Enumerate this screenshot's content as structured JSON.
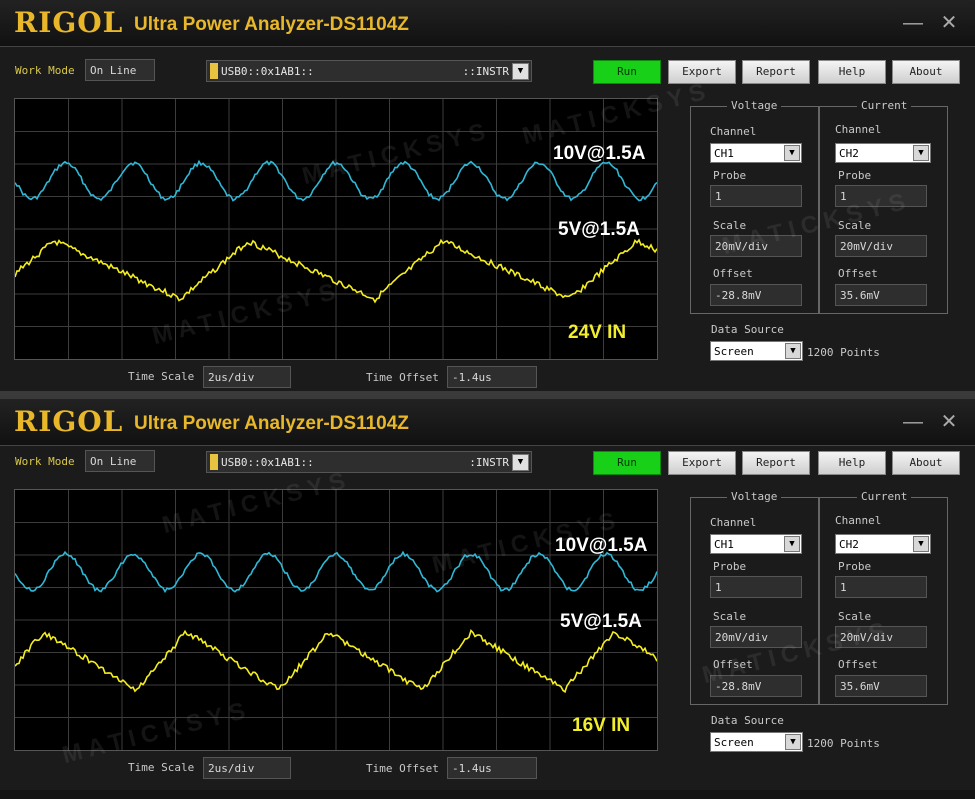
{
  "windows": [
    {
      "logo": "RIGOL",
      "app_title": "Ultra Power Analyzer-DS1104Z",
      "work_mode_label": "Work Mode",
      "work_mode_value": "On Line",
      "usb_resource": "USB0::0x1AB1::",
      "usb_suffix": "::INSTR",
      "buttons": {
        "run": "Run",
        "export": "Export",
        "report": "Report",
        "help": "Help",
        "about": "About"
      },
      "overlay_labels": {
        "upper": "10V@1.5A",
        "lower": "5V@1.5A",
        "input": "24V IN"
      },
      "voltage": {
        "title": "Voltage",
        "channel_label": "Channel",
        "channel": "CH1",
        "probe_label": "Probe",
        "probe": "1",
        "scale_label": "Scale",
        "scale": "20mV/div",
        "offset_label": "Offset",
        "offset": "-28.8mV"
      },
      "current": {
        "title": "Current",
        "channel_label": "Channel",
        "channel": "CH2",
        "probe_label": "Probe",
        "probe": "1",
        "scale_label": "Scale",
        "scale": "20mV/div",
        "offset_label": "Offset",
        "offset": "35.6mV"
      },
      "data_source_label": "Data Source",
      "data_source": "Screen",
      "points": "1200 Points",
      "time_scale_label": "Time Scale",
      "time_scale": "2us/div",
      "time_offset_label": "Time Offset",
      "time_offset": "-1.4us",
      "trace_colors": {
        "ch1": "#2fb8d6",
        "ch2": "#f5ee1e"
      }
    },
    {
      "logo": "RIGOL",
      "app_title": "Ultra Power Analyzer-DS1104Z",
      "work_mode_label": "Work Mode",
      "work_mode_value": "On Line",
      "usb_resource": "USB0::0x1AB1::",
      "usb_suffix": ":INSTR",
      "buttons": {
        "run": "Run",
        "export": "Export",
        "report": "Report",
        "help": "Help",
        "about": "About"
      },
      "overlay_labels": {
        "upper": "10V@1.5A",
        "lower": "5V@1.5A",
        "input": "16V IN"
      },
      "voltage": {
        "title": "Voltage",
        "channel_label": "Channel",
        "channel": "CH1",
        "probe_label": "Probe",
        "probe": "1",
        "scale_label": "Scale",
        "scale": "20mV/div",
        "offset_label": "Offset",
        "offset": "-28.8mV"
      },
      "current": {
        "title": "Current",
        "channel_label": "Channel",
        "channel": "CH2",
        "probe_label": "Probe",
        "probe": "1",
        "scale_label": "Scale",
        "scale": "20mV/div",
        "offset_label": "Offset",
        "offset": "35.6mV"
      },
      "data_source_label": "Data Source",
      "data_source": "Screen",
      "points": "1200 Points",
      "time_scale_label": "Time Scale",
      "time_scale": "2us/div",
      "time_offset_label": "Time Offset",
      "time_offset": "-1.4us",
      "trace_colors": {
        "ch1": "#2fb8d6",
        "ch2": "#f5ee1e"
      }
    }
  ],
  "watermark": "MATICKSYS"
}
